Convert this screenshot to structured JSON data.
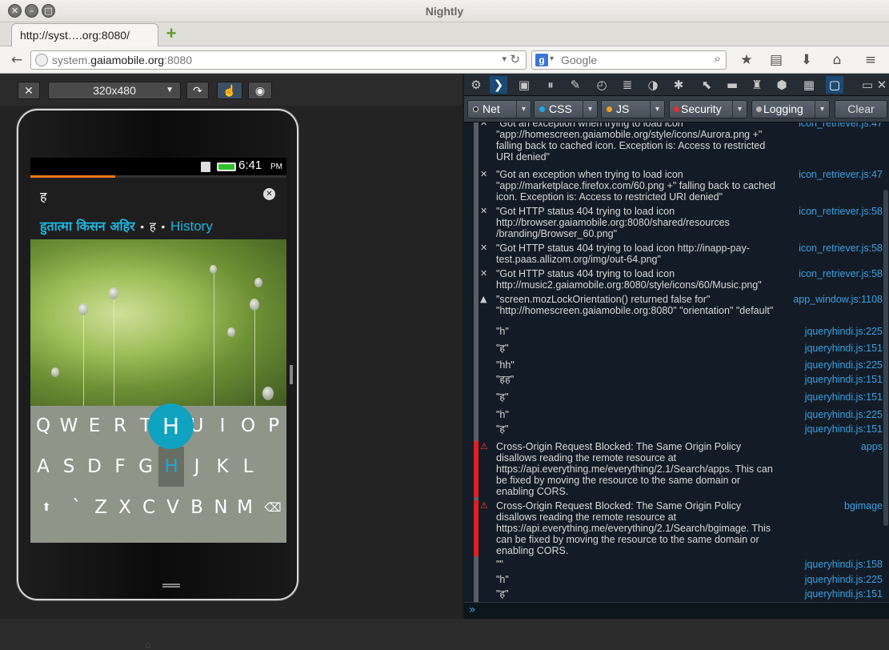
{
  "window": {
    "title": "Nightly"
  },
  "tab": {
    "title": "http://syst….org:8080/"
  },
  "nav": {
    "url_prefix": "system.",
    "url_host": "gaiamobile.org",
    "url_port": ":8080",
    "search_placeholder": "Google"
  },
  "responsive": {
    "close_label": "✕",
    "size_label": "320x480"
  },
  "phone": {
    "clock": "6:41",
    "ampm": "PM",
    "progress": 0.33,
    "search_text": "ह",
    "suggestion_1": "हुतात्मा किसन अहिर",
    "suggestion_2": "ह",
    "suggestion_3": "History",
    "keyboard": {
      "row1": [
        "Q",
        "W",
        "E",
        "R",
        "T",
        "",
        "U",
        "I",
        "O",
        "P"
      ],
      "row2": [
        "A",
        "S",
        "D",
        "F",
        "G",
        "H",
        "J",
        "K",
        "L"
      ],
      "row3": [
        "`",
        "Z",
        "X",
        "C",
        "V",
        "B",
        "N",
        "M"
      ],
      "bubble": "H"
    }
  },
  "devtools": {
    "filters": {
      "net": "Net",
      "css": "CSS",
      "js": "JS",
      "security": "Security",
      "logging": "Logging",
      "clear": "Clear"
    },
    "messages": [
      {
        "icon": "✕",
        "text": "\"Got an exception when trying to load icon \"app://homescreen.gaiamobile.org/style/icons/Aurora.png +\" falling back to cached icon. Exception is: Access to restricted URI denied\"",
        "src": "icon_retriever.js:47"
      },
      {
        "icon": "✕",
        "text": "\"Got an exception when trying to load icon \"app://marketplace.firefox.com/60.png +\" falling back to cached icon. Exception is: Access to restricted URI denied\"",
        "src": "icon_retriever.js:47"
      },
      {
        "icon": "✕",
        "text": "\"Got HTTP status 404 trying to load icon http://browser.gaiamobile.org:8080/shared/resources /branding/Browser_60.png\"",
        "src": "icon_retriever.js:58"
      },
      {
        "icon": "✕",
        "text": "\"Got HTTP status 404 trying to load icon http://inapp-pay-test.paas.allizom.org/img/out-64.png\"",
        "src": "icon_retriever.js:58"
      },
      {
        "icon": "✕",
        "text": "\"Got HTTP status 404 trying to load icon http://music2.gaiamobile.org:8080/style/icons/60/Music.png\"",
        "src": "icon_retriever.js:58"
      },
      {
        "icon": "▲",
        "text": "\"screen.mozLockOrientation() returned false for\" \"http://homescreen.gaiamobile.org:8080\" \"orientation\" \"default\"",
        "src": "app_window.js:1108"
      },
      {
        "icon": "",
        "text": "\"h\"",
        "src": "jqueryhindi.js:225"
      },
      {
        "icon": "",
        "text": "\"ह\"",
        "src": "jqueryhindi.js:151"
      },
      {
        "icon": "",
        "text": "\"hh\"",
        "src": "jqueryhindi.js:225"
      },
      {
        "icon": "",
        "text": "\"हह\"",
        "src": "jqueryhindi.js:151"
      },
      {
        "icon": "",
        "text": "\"ह\"",
        "src": "jqueryhindi.js:151"
      },
      {
        "icon": "",
        "text": "\"h\"",
        "src": "jqueryhindi.js:225"
      },
      {
        "icon": "",
        "text": "\"ह\"",
        "src": "jqueryhindi.js:151"
      },
      {
        "icon": "⚠",
        "text": "Cross-Origin Request Blocked: The Same Origin Policy disallows reading the remote resource at https://api.everything.me/everything/2.1/Search/apps. This can be fixed by moving the resource to the same domain or enabling CORS.",
        "src": "apps"
      },
      {
        "icon": "⚠",
        "text": "Cross-Origin Request Blocked: The Same Origin Policy disallows reading the remote resource at https://api.everything.me/everything/2.1/Search/bgimage. This can be fixed by moving the resource to the same domain or enabling CORS.",
        "src": "bgimage"
      },
      {
        "icon": "",
        "text": "\"\"",
        "src": "jqueryhindi.js:158"
      },
      {
        "icon": "",
        "text": "\"h\"",
        "src": "jqueryhindi.js:225"
      },
      {
        "icon": "",
        "text": "\"ह\"",
        "src": "jqueryhindi.js:151"
      }
    ]
  },
  "colors": {
    "accent": "#1fb5e0",
    "error_bar": "#e02020",
    "link": "#3b9fe0",
    "progress": "#f07a1a"
  }
}
